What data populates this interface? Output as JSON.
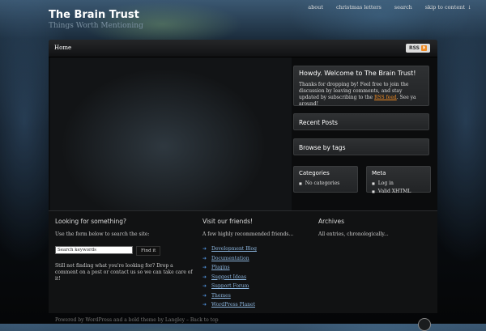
{
  "header": {
    "title": "The Brain Trust",
    "tagline": "Things Worth Mentioning"
  },
  "topnav": {
    "about": "about",
    "christmas": "christmas letters",
    "search": "search",
    "skip": "skip to content",
    "skip_arrow": "↓"
  },
  "navbar": {
    "home": "Home",
    "rss_label": "RSS"
  },
  "welcome": {
    "title": "Howdy. Welcome to The Brain Trust!",
    "text_before": "Thanks for dropping by! Feel free to join the discussion by leaving comments, and stay updated by subscribing to the ",
    "rss_link": "RSS feed",
    "text_after": ". See ya around!"
  },
  "recent_posts": "Recent Posts",
  "browse_tags": "Browse by tags",
  "categories": {
    "title": "Categories",
    "items": [
      "No categories"
    ]
  },
  "meta": {
    "title": "Meta",
    "items": [
      "Log in",
      "Valid XHTML"
    ]
  },
  "footer": {
    "search": {
      "title": "Looking for something?",
      "intro": "Use the form below to search the site:",
      "placeholder": "Search keywords",
      "button": "Find it",
      "outro": "Still not finding what you're looking for? Drop a comment on a post or contact us so we can take care of it!"
    },
    "friends": {
      "title": "Visit our friends!",
      "intro": "A few highly recommended friends...",
      "links": [
        "Development Blog",
        "Documentation",
        "Plugins",
        "Suggest Ideas",
        "Support Forum",
        "Themes",
        "WordPress Planet"
      ]
    },
    "archives": {
      "title": "Archives",
      "intro": "All entries, chronologically..."
    }
  },
  "bottom_text": "Powered by WordPress and a bold theme by Langley – Back to top",
  "colors": {
    "accent": "#ef8b24",
    "link": "#8db7e0"
  }
}
